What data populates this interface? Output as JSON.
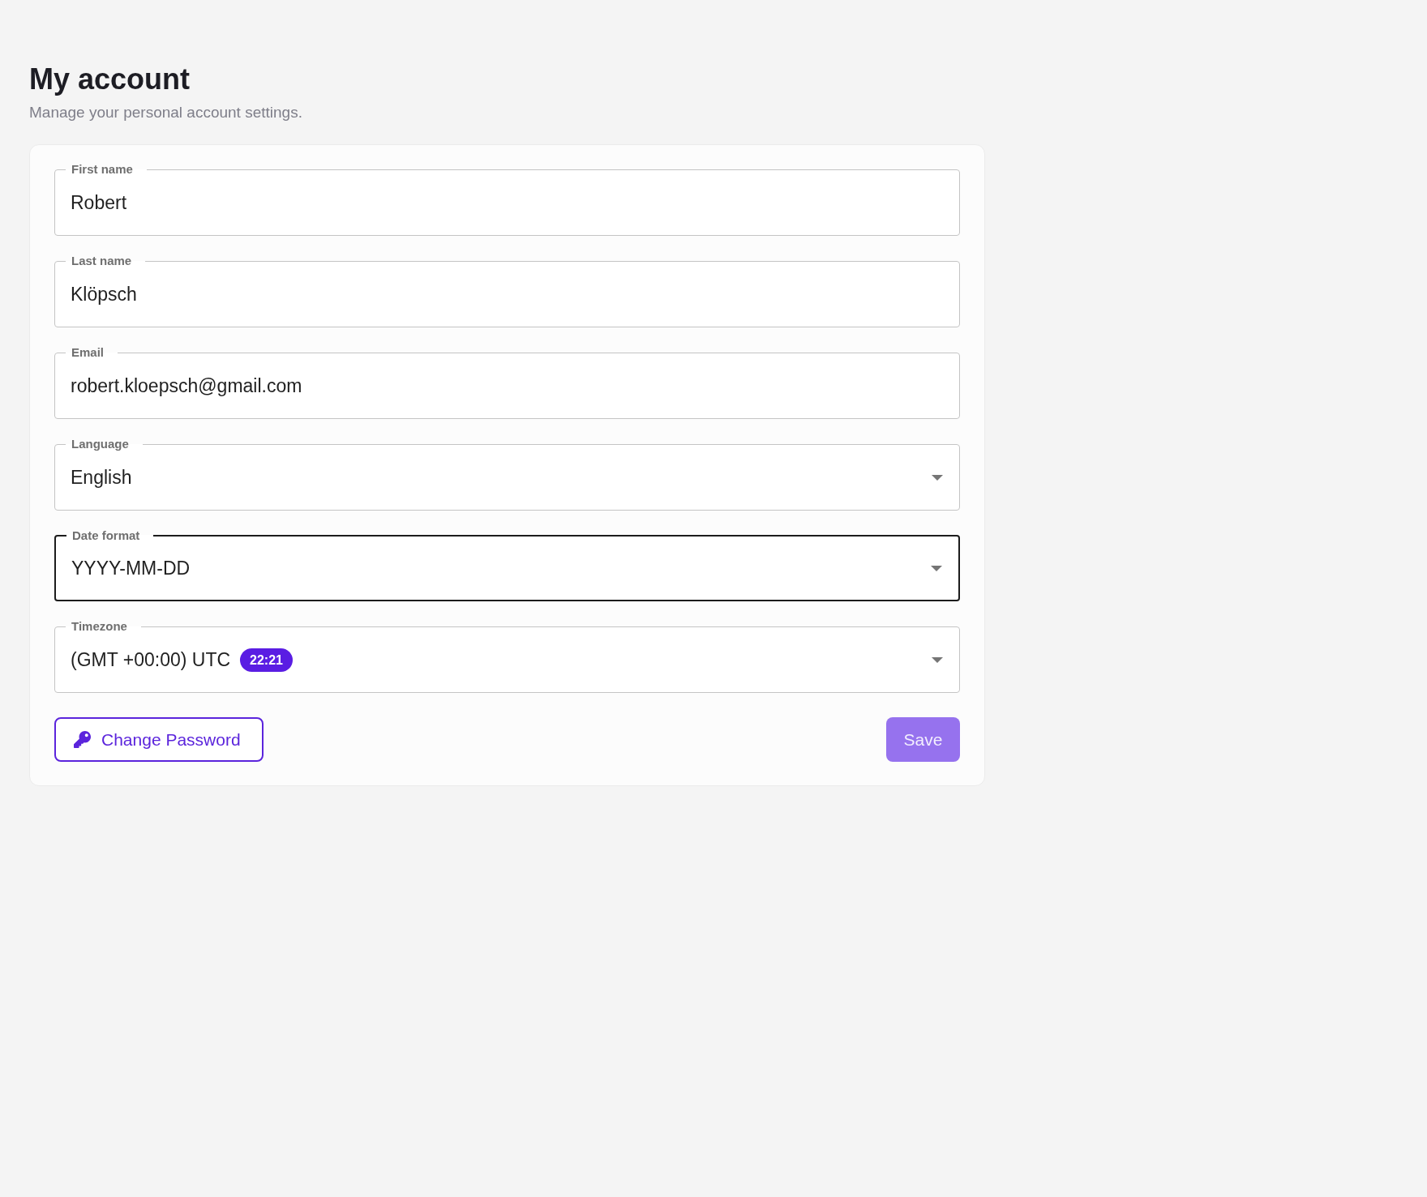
{
  "page": {
    "title": "My account",
    "subtitle": "Manage your personal account settings."
  },
  "form": {
    "fields": [
      {
        "kind": "text",
        "label": "First name",
        "value": "Robert",
        "focused": false
      },
      {
        "kind": "text",
        "label": "Last name",
        "value": "Klöpsch",
        "focused": false
      },
      {
        "kind": "text",
        "label": "Email",
        "value": "robert.kloepsch@gmail.com",
        "focused": false
      },
      {
        "kind": "select",
        "label": "Language",
        "value": "English",
        "focused": false
      },
      {
        "kind": "select",
        "label": "Date format",
        "value": "YYYY-MM-DD",
        "focused": true
      },
      {
        "kind": "select",
        "label": "Timezone",
        "value": "(GMT +00:00) UTC",
        "badge": "22:21",
        "focused": false
      }
    ]
  },
  "actions": {
    "change_password": {
      "label": "Change Password"
    },
    "save": {
      "label": "Save",
      "disabled": true
    }
  }
}
